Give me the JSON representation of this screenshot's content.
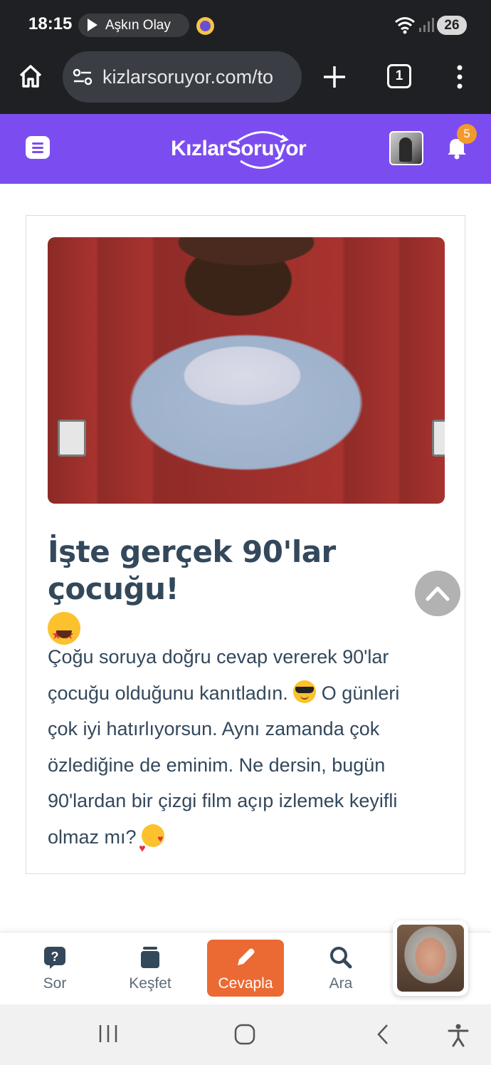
{
  "status_bar": {
    "time": "18:15",
    "media_title": "Aşkın Olay",
    "battery": "26"
  },
  "browser": {
    "url": "kizlarsoruyor.com/to",
    "tab_count": "1"
  },
  "site_header": {
    "logo_text": "KızlarSoruyor",
    "notification_count": "5",
    "brand_color": "#7b4df0"
  },
  "result": {
    "title": "İşte gerçek 90'lar çocuğu!",
    "body_lines": [
      "Çoğu soruya doğru cevap vererek 90'lar",
      "çocuğu olduğunu kanıtladın.",
      "O günleri",
      "çok iyi hatırlıyorsun. Aynı zamanda çok",
      "özlediğine de eminim. Ne dersin, bugün",
      "90'lardan bir çizgi film açıp izlemek keyifli",
      "olmaz mı?"
    ]
  },
  "bottom_nav": {
    "items": [
      {
        "label": "Sor",
        "icon": "question-bubble-icon"
      },
      {
        "label": "Keşfet",
        "icon": "cards-icon"
      },
      {
        "label": "Cevapla",
        "icon": "pencil-icon"
      },
      {
        "label": "Ara",
        "icon": "search-icon"
      }
    ],
    "accent_color": "#eb6a33"
  }
}
